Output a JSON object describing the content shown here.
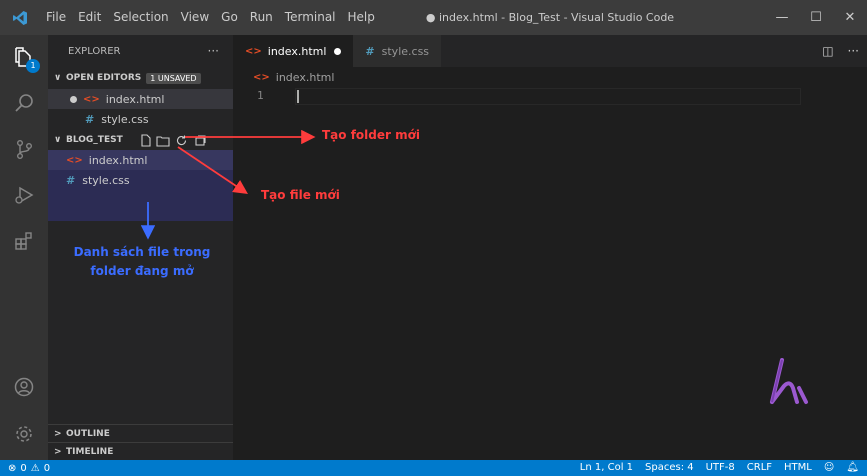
{
  "window": {
    "title": "● index.html - Blog_Test - Visual Studio Code"
  },
  "menu": [
    "File",
    "Edit",
    "Selection",
    "View",
    "Go",
    "Run",
    "Terminal",
    "Help"
  ],
  "explorer": {
    "header": "EXPLORER",
    "more": "···",
    "open_editors": {
      "label": "OPEN EDITORS",
      "badge": "1 UNSAVED",
      "files": [
        {
          "name": "index.html",
          "unsaved": true
        },
        {
          "name": "style.css"
        }
      ]
    },
    "folder": {
      "label": "BLOG_TEST",
      "files": [
        "index.html",
        "style.css"
      ]
    },
    "outline": "OUTLINE",
    "timeline": "TIMELINE"
  },
  "activity": {
    "badge": "1"
  },
  "tabs": [
    {
      "label": "index.html",
      "active": true,
      "dirty": true
    },
    {
      "label": "style.css",
      "active": false
    }
  ],
  "breadcrumb": "index.html",
  "editor": {
    "line_number": "1"
  },
  "annotations": {
    "new_folder": "Tạo folder mới",
    "new_file": "Tạo file mới",
    "file_list": "Danh sách file trong folder đang mở"
  },
  "status": {
    "problems_errors": "0",
    "problems_warnings": "0",
    "position": "Ln 1, Col 1",
    "spaces": "Spaces: 4",
    "encoding": "UTF-8",
    "eol": "CRLF",
    "language": "HTML"
  },
  "colors": {
    "accent": "#007acc",
    "annotation_red": "#ff3c3c",
    "annotation_blue": "#3b6cff",
    "logo": "#9b59d0"
  }
}
